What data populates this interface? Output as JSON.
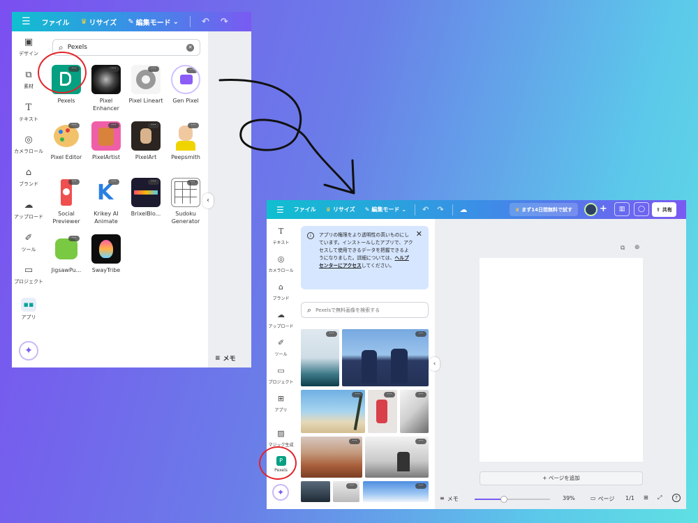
{
  "colors": {
    "accent_red": "#e2232a",
    "pexels_green": "#05a081",
    "info_bg": "#d6e6ff"
  },
  "window1": {
    "topbar": {
      "menu_icon": "hamburger-icon",
      "file": "ファイル",
      "resize": "リサイズ",
      "edit_mode": "編集モード"
    },
    "sidebar": [
      {
        "label": "デザイン",
        "icon": "layout-icon"
      },
      {
        "label": "素材",
        "icon": "shapes-icon"
      },
      {
        "label": "テキスト",
        "icon": "text-icon"
      },
      {
        "label": "カメラロール",
        "icon": "camera-icon"
      },
      {
        "label": "ブランド",
        "icon": "brand-icon"
      },
      {
        "label": "アップロード",
        "icon": "cloud-upload-icon"
      },
      {
        "label": "ツール",
        "icon": "pen-icon"
      },
      {
        "label": "プロジェクト",
        "icon": "folder-icon"
      },
      {
        "label": "アプリ",
        "icon": "apps-icon"
      }
    ],
    "search_value": "Pexels",
    "apps": [
      {
        "label": "Pexels"
      },
      {
        "label": "Pixel Enhancer"
      },
      {
        "label": "Pixel Lineart"
      },
      {
        "label": "Gen Pixel"
      },
      {
        "label": "Pixel Editor"
      },
      {
        "label": "PixelArtist"
      },
      {
        "label": "PixelArt"
      },
      {
        "label": "Peepsmith"
      },
      {
        "label": "Social Previewer"
      },
      {
        "label": "Krikey AI Animate"
      },
      {
        "label": "BrixelBlo..."
      },
      {
        "label": "Sudoku Generator"
      },
      {
        "label": "JigsawPu..."
      },
      {
        "label": "SwayTribe"
      }
    ],
    "memo": "メモ"
  },
  "window2": {
    "topbar": {
      "file": "ファイル",
      "resize": "リサイズ",
      "edit_mode": "編集モード",
      "trial": "まず14日間無料で試す",
      "share": "共有"
    },
    "sidebar": [
      {
        "label": "テキスト"
      },
      {
        "label": "カメラロール"
      },
      {
        "label": "ブランド"
      },
      {
        "label": "アップロード"
      },
      {
        "label": "ツール"
      },
      {
        "label": "プロジェクト"
      },
      {
        "label": "アプリ"
      },
      {
        "label": "マジック生成"
      },
      {
        "label": "Pexels"
      }
    ],
    "notice": {
      "text_a": "アプリの権限をより透明性の高いものにしています。インストールしたアプリで、アクセスして使用できるデータを把握できるようになりました。詳細については、",
      "link": "ヘルプセンターにアクセス",
      "text_b": "してください。"
    },
    "search_placeholder": "Pexelsで無料画像を検索する",
    "add_page": "+ ページを追加",
    "bottom": {
      "memo": "メモ",
      "zoom": "39%",
      "zoom_value": 0.39,
      "page_label": "ページ",
      "page_count": "1/1"
    }
  }
}
